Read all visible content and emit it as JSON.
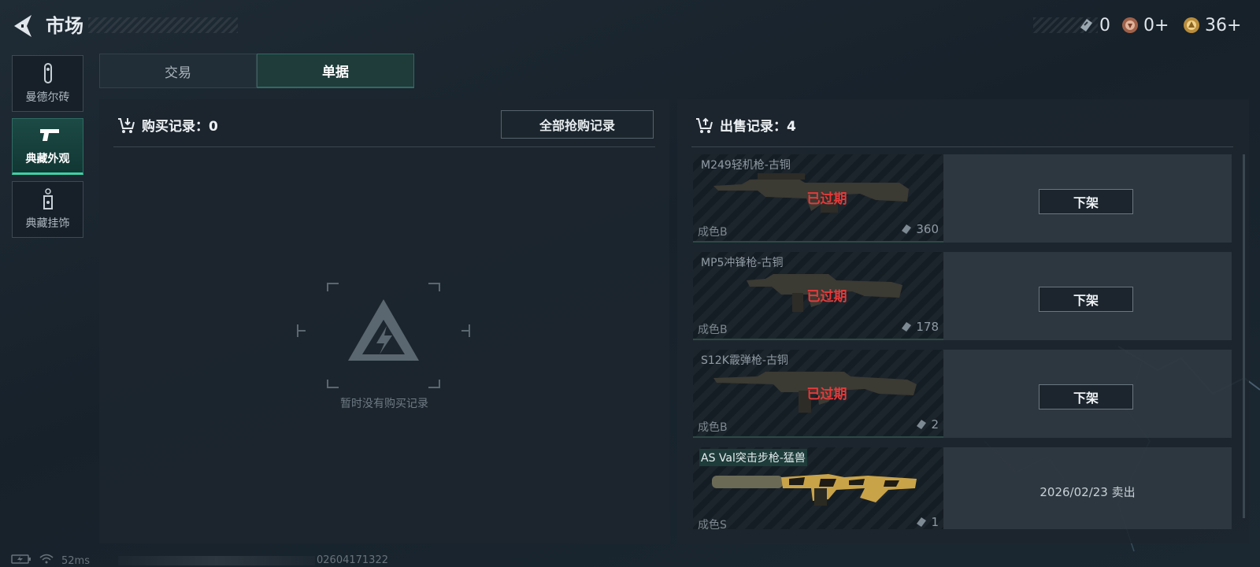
{
  "header": {
    "title": "市场"
  },
  "currencies": [
    {
      "icon": "ticket-icon",
      "value": "0"
    },
    {
      "icon": "bronze-coin-icon",
      "value": "0+"
    },
    {
      "icon": "gold-coin-icon",
      "value": "36+"
    }
  ],
  "sidebar": {
    "items": [
      {
        "label": "曼德尔砖",
        "icon": "mandel-brick-icon",
        "active": false
      },
      {
        "label": "典藏外观",
        "icon": "pistol-icon",
        "active": true
      },
      {
        "label": "典藏挂饰",
        "icon": "charm-tag-icon",
        "active": false
      }
    ]
  },
  "tabs": [
    {
      "label": "交易",
      "active": false
    },
    {
      "label": "单据",
      "active": true
    }
  ],
  "buy": {
    "title": "购买记录：0",
    "grab_all_label": "全部抢购记录",
    "empty_text": "暂时没有购买记录"
  },
  "sell": {
    "title": "出售记录：4",
    "items": [
      {
        "name": "M249轻机枪-古铜",
        "grade": "成色B",
        "price": "360",
        "status": "已过期",
        "action": "下架"
      },
      {
        "name": "MP5冲锋枪-古铜",
        "grade": "成色B",
        "price": "178",
        "status": "已过期",
        "action": "下架"
      },
      {
        "name": "S12K霰弹枪-古铜",
        "grade": "成色B",
        "price": "2",
        "status": "已过期",
        "action": "下架"
      },
      {
        "name": "AS Val突击步枪-猛兽",
        "grade": "成色S",
        "price": "1",
        "sold_text": "2026/02/23 卖出"
      }
    ]
  },
  "footer": {
    "ping": "52ms",
    "id": "02604171322"
  },
  "colors": {
    "accent": "#3fd0a4",
    "expired": "#e43a3a",
    "highlight_bg": "#1d3c3a"
  }
}
